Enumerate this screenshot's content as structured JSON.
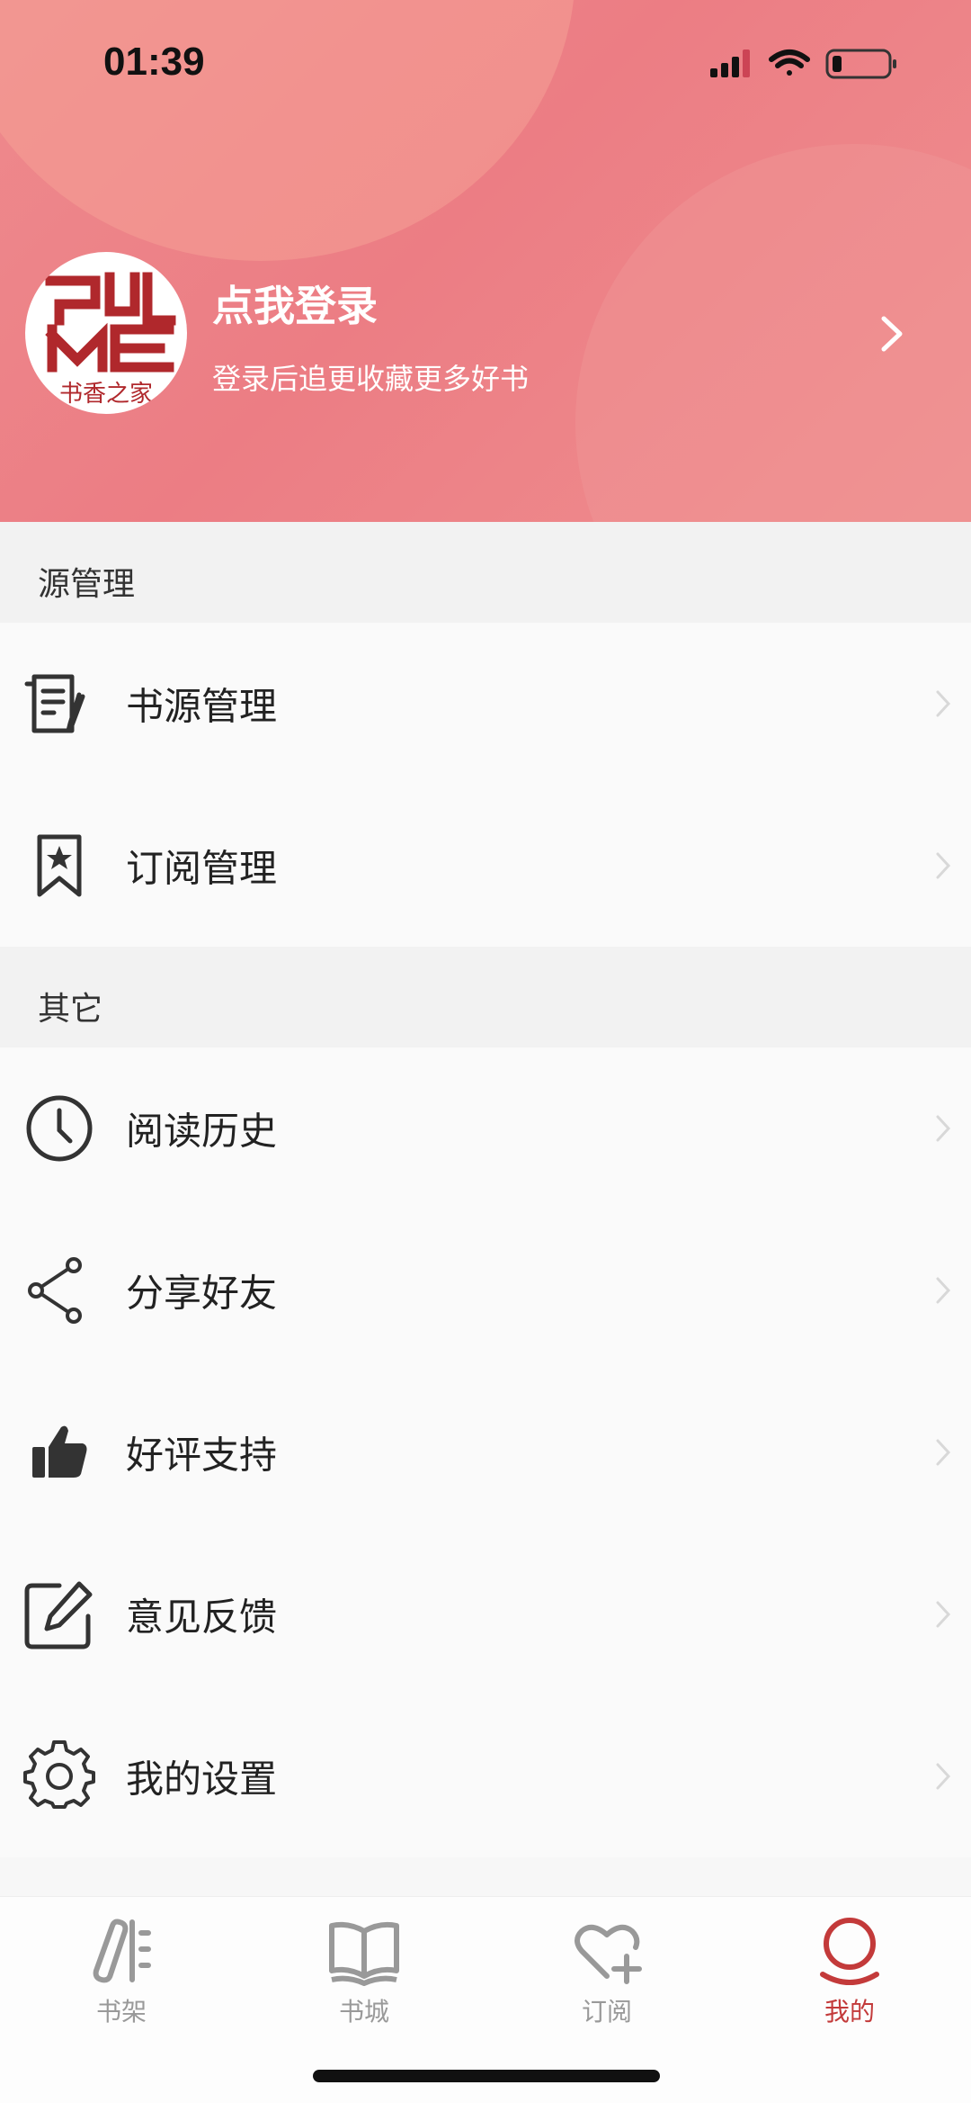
{
  "status_bar": {
    "time": "01:39"
  },
  "header": {
    "avatar_text": "书香之家",
    "login_title": "点我登录",
    "login_subtitle": "登录后追更收藏更多好书"
  },
  "sections": [
    {
      "title": "源管理",
      "items": [
        {
          "label": "书源管理",
          "icon": "book-source-icon"
        },
        {
          "label": "订阅管理",
          "icon": "bookmark-star-icon"
        }
      ]
    },
    {
      "title": "其它",
      "items": [
        {
          "label": "阅读历史",
          "icon": "clock-icon"
        },
        {
          "label": "分享好友",
          "icon": "share-icon"
        },
        {
          "label": "好评支持",
          "icon": "thumbs-up-icon"
        },
        {
          "label": "意见反馈",
          "icon": "edit-icon"
        },
        {
          "label": "我的设置",
          "icon": "gear-icon"
        }
      ]
    }
  ],
  "tabbar": {
    "tabs": [
      {
        "label": "书架",
        "icon": "bookshelf-icon"
      },
      {
        "label": "书城",
        "icon": "open-book-icon"
      },
      {
        "label": "订阅",
        "icon": "heart-plus-icon"
      },
      {
        "label": "我的",
        "icon": "user-icon",
        "active": true
      }
    ]
  },
  "colors": {
    "header_gradient": "#ec7d84",
    "active_tab": "#c33a3a",
    "icon_color": "#333333"
  }
}
